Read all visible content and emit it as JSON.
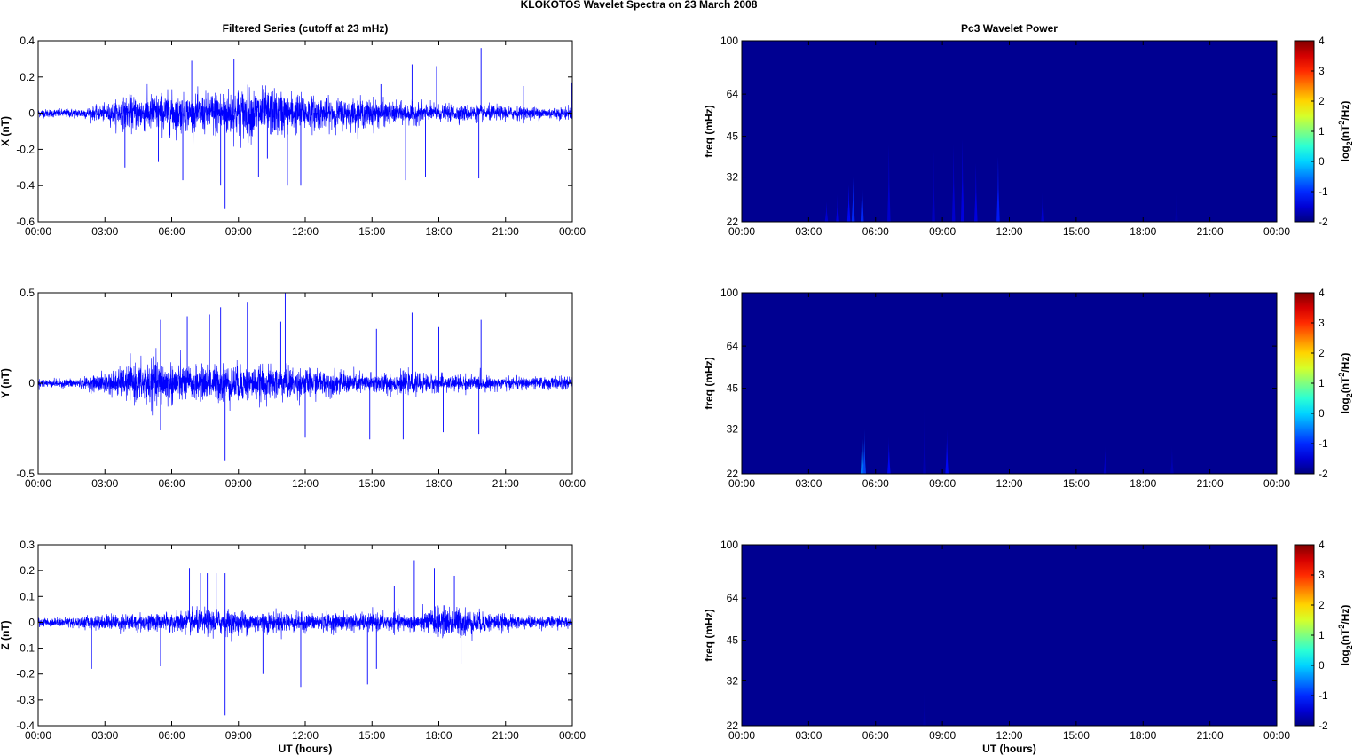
{
  "title": "KLOKOTOS Wavelet Spectra on 23 March     2008",
  "chart_data": [
    {
      "type": "line",
      "title": "Filtered Series (cutoff at 23 mHz)",
      "component": "X",
      "ylabel": "X (nT)",
      "xlabel": "",
      "ylim": [
        -0.6,
        0.4
      ],
      "yticks": [
        "-0.6",
        "-0.4",
        "-0.2",
        "0",
        "0.2",
        "0.4"
      ],
      "yvals": [
        -0.6,
        -0.4,
        -0.2,
        0,
        0.2,
        0.4
      ],
      "xticks": [
        "00:00",
        "03:00",
        "06:00",
        "09:00",
        "12:00",
        "15:00",
        "18:00",
        "21:00",
        "00:00"
      ],
      "xlim_hours": [
        0,
        24
      ],
      "envelope_by_hour": [
        0.02,
        0.02,
        0.025,
        0.04,
        0.08,
        0.09,
        0.1,
        0.08,
        0.11,
        0.12,
        0.12,
        0.11,
        0.09,
        0.07,
        0.07,
        0.07,
        0.05,
        0.05,
        0.04,
        0.04,
        0.04,
        0.035,
        0.03,
        0.03,
        0.03
      ],
      "spikes": [
        [
          8.4,
          -0.53
        ],
        [
          8.2,
          -0.4
        ],
        [
          6.5,
          -0.37
        ],
        [
          9.9,
          -0.35
        ],
        [
          11.2,
          -0.4
        ],
        [
          11.8,
          -0.4
        ],
        [
          16.5,
          -0.37
        ],
        [
          17.4,
          -0.35
        ],
        [
          19.8,
          -0.36
        ],
        [
          16.8,
          0.27
        ],
        [
          17.9,
          0.26
        ],
        [
          19.9,
          0.36
        ],
        [
          15.4,
          0.16
        ],
        [
          8.8,
          0.3
        ],
        [
          6.9,
          0.29
        ],
        [
          21.8,
          0.15
        ],
        [
          3.9,
          -0.3
        ],
        [
          5.4,
          -0.27
        ],
        [
          10.3,
          -0.25
        ],
        [
          23.98,
          0.17
        ]
      ]
    },
    {
      "type": "line",
      "title": "",
      "component": "Y",
      "ylabel": "Y (nT)",
      "xlabel": "",
      "ylim": [
        -0.5,
        0.5
      ],
      "yticks": [
        "-0.5",
        "0",
        "0.5"
      ],
      "yvals": [
        -0.5,
        0,
        0.5
      ],
      "xticks": [
        "00:00",
        "03:00",
        "06:00",
        "09:00",
        "12:00",
        "15:00",
        "18:00",
        "21:00",
        "00:00"
      ],
      "xlim_hours": [
        0,
        24
      ],
      "envelope_by_hour": [
        0.02,
        0.02,
        0.025,
        0.05,
        0.08,
        0.11,
        0.1,
        0.08,
        0.09,
        0.09,
        0.08,
        0.08,
        0.07,
        0.06,
        0.05,
        0.05,
        0.05,
        0.05,
        0.04,
        0.04,
        0.035,
        0.03,
        0.03,
        0.03,
        0.03
      ],
      "spikes": [
        [
          8.4,
          -0.43
        ],
        [
          11.1,
          0.5
        ],
        [
          9.4,
          0.45
        ],
        [
          8.2,
          0.42
        ],
        [
          7.7,
          0.38
        ],
        [
          6.7,
          0.37
        ],
        [
          5.5,
          0.35
        ],
        [
          10.9,
          0.34
        ],
        [
          12.0,
          -0.3
        ],
        [
          14.9,
          -0.31
        ],
        [
          16.4,
          -0.31
        ],
        [
          16.8,
          0.39
        ],
        [
          18.2,
          -0.27
        ],
        [
          19.8,
          -0.28
        ],
        [
          19.9,
          0.35
        ],
        [
          5.5,
          -0.26
        ],
        [
          18.0,
          0.31
        ],
        [
          15.2,
          0.3
        ]
      ]
    },
    {
      "type": "line",
      "title": "",
      "component": "Z",
      "ylabel": "Z (nT)",
      "xlabel": "UT (hours)",
      "ylim": [
        -0.4,
        0.3
      ],
      "yticks": [
        "-0.4",
        "-0.3",
        "-0.2",
        "-0.1",
        "0",
        "0.1",
        "0.2",
        "0.3"
      ],
      "yvals": [
        -0.4,
        -0.3,
        -0.2,
        -0.1,
        0,
        0.1,
        0.2,
        0.3
      ],
      "xticks": [
        "00:00",
        "03:00",
        "06:00",
        "09:00",
        "12:00",
        "15:00",
        "18:00",
        "21:00",
        "00:00"
      ],
      "xlim_hours": [
        0,
        24
      ],
      "envelope_by_hour": [
        0.015,
        0.015,
        0.02,
        0.025,
        0.03,
        0.03,
        0.035,
        0.04,
        0.045,
        0.04,
        0.035,
        0.035,
        0.03,
        0.03,
        0.03,
        0.03,
        0.03,
        0.03,
        0.05,
        0.05,
        0.035,
        0.025,
        0.02,
        0.02,
        0.02
      ],
      "spikes": [
        [
          8.4,
          -0.36
        ],
        [
          6.8,
          0.21
        ],
        [
          7.3,
          0.19
        ],
        [
          7.6,
          0.19
        ],
        [
          8.0,
          0.19
        ],
        [
          8.4,
          0.19
        ],
        [
          10.1,
          -0.2
        ],
        [
          11.8,
          -0.25
        ],
        [
          15.2,
          -0.18
        ],
        [
          16.0,
          0.14
        ],
        [
          16.9,
          0.24
        ],
        [
          17.8,
          0.21
        ],
        [
          18.7,
          0.18
        ],
        [
          19.0,
          -0.16
        ],
        [
          2.4,
          -0.18
        ],
        [
          5.5,
          -0.17
        ],
        [
          14.8,
          -0.24
        ]
      ]
    },
    {
      "type": "heatmap",
      "title": "Pc3 Wavelet Power",
      "component": "X",
      "ylabel": "freq (mHz)",
      "xlabel": "",
      "ylim_mHz": [
        22,
        100
      ],
      "yscale": "log",
      "yticks": [
        "22",
        "32",
        "45",
        "64",
        "100"
      ],
      "yvals": [
        22,
        32,
        45,
        64,
        100
      ],
      "xticks": [
        "00:00",
        "03:00",
        "06:00",
        "09:00",
        "12:00",
        "15:00",
        "18:00",
        "21:00",
        "00:00"
      ],
      "background_log2": -1.9,
      "clim": [
        -2,
        4
      ],
      "cticks": [
        "4",
        "3",
        "2",
        "1",
        "0",
        "-1",
        "-2"
      ],
      "cvals": [
        4,
        3,
        2,
        1,
        0,
        -1,
        -2
      ],
      "streaks_hour_topfreq_log2": [
        [
          3.8,
          26,
          -1.5
        ],
        [
          4.3,
          28,
          -1.4
        ],
        [
          4.8,
          30,
          -1.2
        ],
        [
          5.0,
          32,
          -1.0
        ],
        [
          5.4,
          34,
          -1.0
        ],
        [
          6.6,
          42,
          -1.5
        ],
        [
          8.6,
          40,
          -1.6
        ],
        [
          9.5,
          42,
          -1.5
        ],
        [
          9.9,
          44,
          -1.4
        ],
        [
          10.5,
          36,
          -1.4
        ],
        [
          11.5,
          38,
          -1.1
        ],
        [
          13.5,
          30,
          -1.5
        ],
        [
          19.5,
          28,
          -1.8
        ]
      ]
    },
    {
      "type": "heatmap",
      "title": "",
      "component": "Y",
      "ylabel": "freq (mHz)",
      "xlabel": "",
      "ylim_mHz": [
        22,
        100
      ],
      "yscale": "log",
      "yticks": [
        "22",
        "32",
        "45",
        "64",
        "100"
      ],
      "yvals": [
        22,
        32,
        45,
        64,
        100
      ],
      "xticks": [
        "00:00",
        "03:00",
        "06:00",
        "09:00",
        "12:00",
        "15:00",
        "18:00",
        "21:00",
        "00:00"
      ],
      "background_log2": -1.9,
      "clim": [
        -2,
        4
      ],
      "cticks": [
        "4",
        "3",
        "2",
        "1",
        "0",
        "-1",
        "-2"
      ],
      "cvals": [
        4,
        3,
        2,
        1,
        0,
        -1,
        -2
      ],
      "streaks_hour_topfreq_log2": [
        [
          5.4,
          36,
          -0.5
        ],
        [
          5.5,
          32,
          -0.8
        ],
        [
          6.6,
          30,
          -1.2
        ],
        [
          8.2,
          40,
          -1.7
        ],
        [
          9.2,
          32,
          -1.2
        ],
        [
          16.3,
          28,
          -1.6
        ],
        [
          19.3,
          28,
          -1.7
        ]
      ]
    },
    {
      "type": "heatmap",
      "title": "",
      "component": "Z",
      "ylabel": "freq (mHz)",
      "xlabel": "UT (hours)",
      "ylim_mHz": [
        22,
        100
      ],
      "yscale": "log",
      "yticks": [
        "22",
        "32",
        "45",
        "64",
        "100"
      ],
      "yvals": [
        22,
        32,
        45,
        64,
        100
      ],
      "xticks": [
        "00:00",
        "03:00",
        "06:00",
        "09:00",
        "12:00",
        "15:00",
        "18:00",
        "21:00",
        "00:00"
      ],
      "background_log2": -1.9,
      "clim": [
        -2,
        4
      ],
      "cticks": [
        "4",
        "3",
        "2",
        "1",
        "0",
        "-1",
        "-2"
      ],
      "cvals": [
        4,
        3,
        2,
        1,
        0,
        -1,
        -2
      ],
      "streaks_hour_topfreq_log2": [
        [
          8.2,
          30,
          -1.8
        ]
      ]
    }
  ],
  "colorbar_label_parts": [
    "log",
    "2",
    "(nT",
    "2",
    "/Hz)"
  ],
  "colors": {
    "series": "#0000ff",
    "axis": "#000000"
  }
}
